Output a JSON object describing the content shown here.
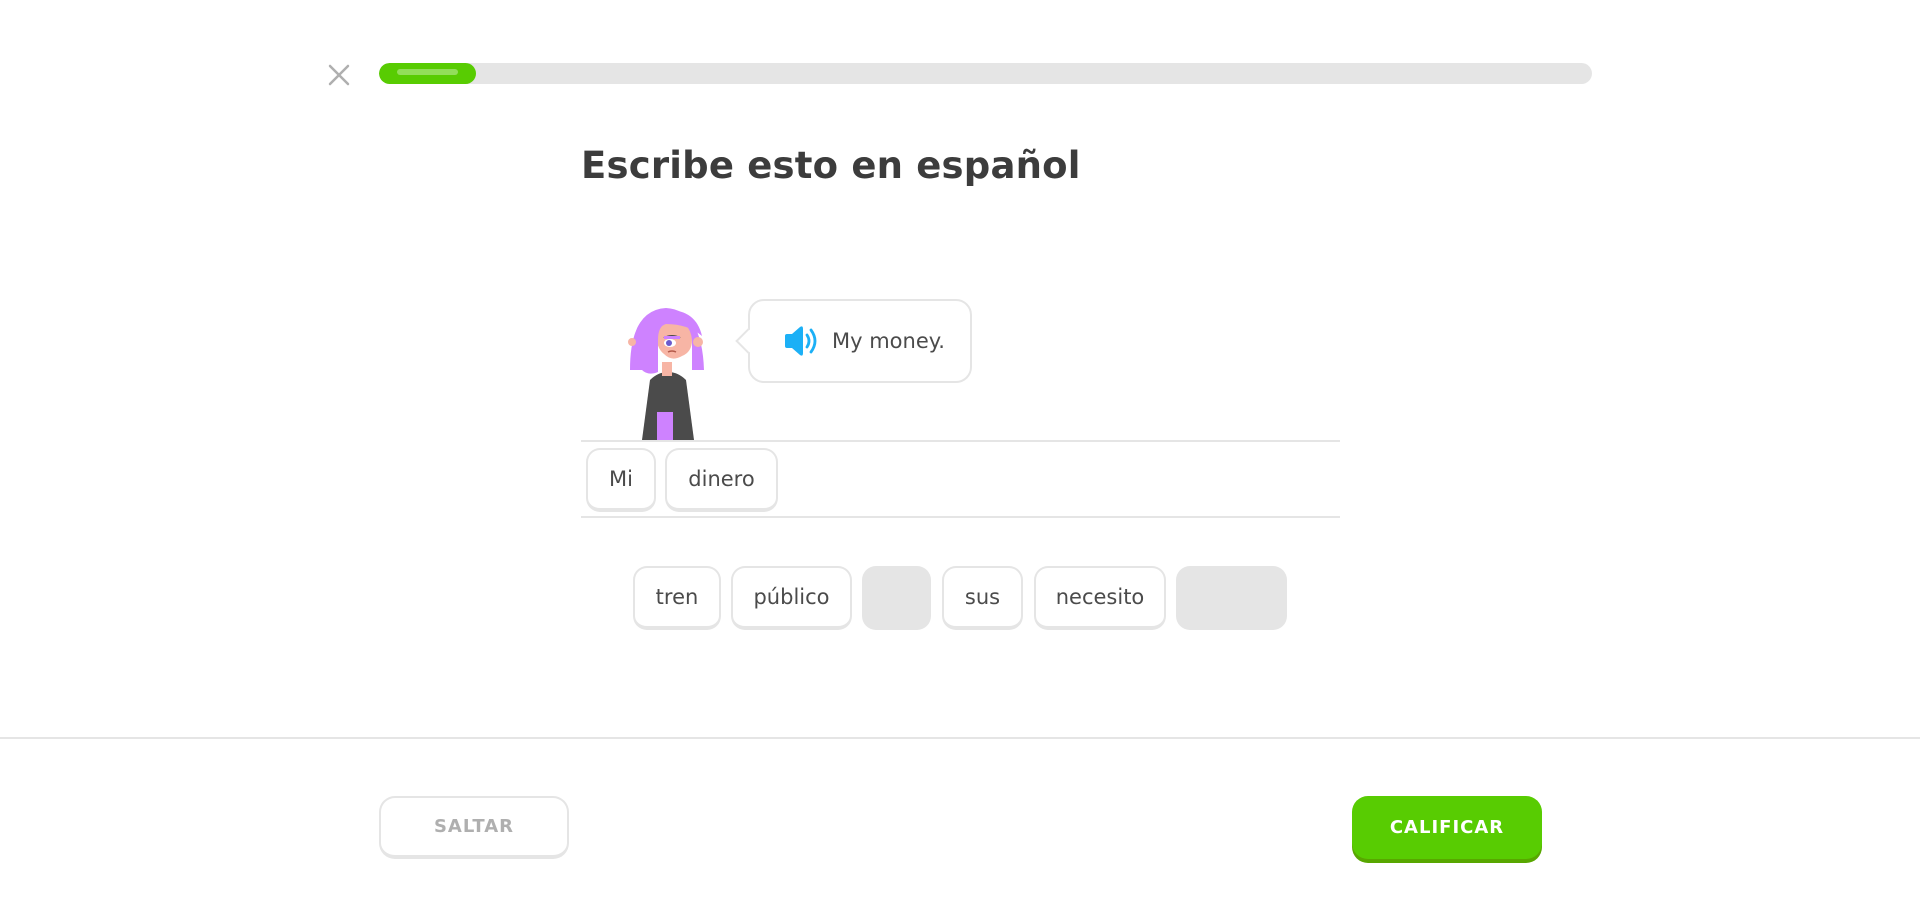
{
  "header": {
    "close_icon": "close-icon",
    "progress_fraction": 0.08,
    "progress_color": "#58cc02"
  },
  "challenge": {
    "title": "Escribe esto en español",
    "prompt_text": "My money.",
    "speaker_icon": "speaker-icon",
    "speaker_color": "#1cb0f6"
  },
  "answer": {
    "selected_words": [
      "Mi",
      "dinero"
    ]
  },
  "word_bank": {
    "tiles": [
      "tren",
      "público",
      "",
      "sus",
      "necesito",
      ""
    ]
  },
  "footer": {
    "skip_label": "SALTAR",
    "check_label": "CALIFICAR",
    "check_color": "#58cc02"
  }
}
